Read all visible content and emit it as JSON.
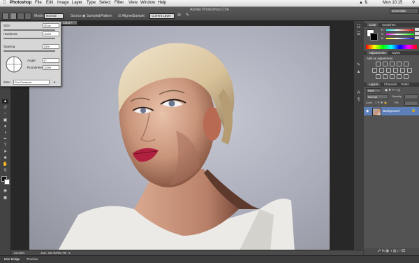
{
  "menubar": {
    "app": "Photoshop",
    "items": [
      "File",
      "Edit",
      "Image",
      "Layer",
      "Type",
      "Select",
      "Filter",
      "View",
      "Window",
      "Help"
    ],
    "clock": "Mon 10:15"
  },
  "window": {
    "title": "Adobe Photoshop CS6",
    "essentials": "Essentials"
  },
  "options": {
    "mode_label": "Mode:",
    "mode_value": "Normal",
    "source_label": "Source:",
    "sampled": "Sampled",
    "pattern": "Pattern",
    "aligned": "Aligned",
    "sample_label": "Sample:",
    "sample_value": "Current Layer"
  },
  "brush_panel": {
    "size_label": "Size:",
    "size_value": "40 px",
    "hardness_label": "Hardness:",
    "hardness_value": "100%",
    "spacing_label": "Spacing",
    "spacing_value": "25%",
    "angle_label": "Angle:",
    "angle_value": "0°",
    "roundness_label": "Roundness:",
    "roundness_value": "100%",
    "size_ctrl_label": "Size:",
    "size_ctrl_value": "Pen Pressure"
  },
  "document": {
    "tab": "HUB.tif *",
    "zoom": "23.33%",
    "doc_size": "Doc: 59.7M/59.7M"
  },
  "bottom_tabs": [
    "Mini Bridge",
    "Timeline"
  ],
  "color_panel": {
    "tabs": [
      "Color",
      "Swatches"
    ],
    "sliders": [
      "R",
      "G",
      "B"
    ]
  },
  "adjustments_panel": {
    "tabs": [
      "Adjustments",
      "Styles"
    ],
    "hint": "Add an adjustment"
  },
  "layers_panel": {
    "tabs": [
      "Layers",
      "Channels",
      "Paths"
    ],
    "kind": "Kind",
    "blend": "Normal",
    "opacity_label": "Opacity:",
    "lock_label": "Lock:",
    "fill_label": "Fill:",
    "layer_name": "Background"
  },
  "icons": {
    "accent": "#5b7fc0",
    "selected_layer": "#5c7fb8"
  }
}
